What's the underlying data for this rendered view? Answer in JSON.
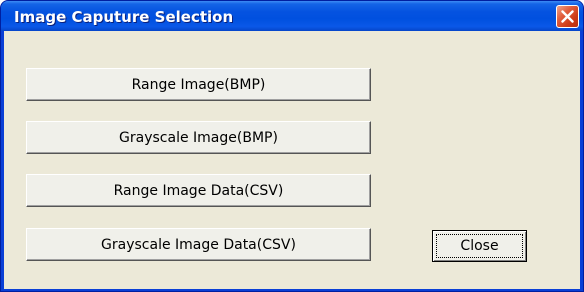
{
  "window": {
    "title": "Image Caputure Selection"
  },
  "buttons": {
    "range_image_bmp": "Range Image(BMP)",
    "grayscale_image_bmp": "Grayscale Image(BMP)",
    "range_image_data_csv": "Range Image Data(CSV)",
    "grayscale_image_data_csv": "Grayscale Image Data(CSV)",
    "close": "Close"
  },
  "colors": {
    "titlebar": "#0050df",
    "client_background": "#ece9d8",
    "close_button": "#cc3a16"
  },
  "icons": {
    "titlebar_close": "close-icon"
  }
}
